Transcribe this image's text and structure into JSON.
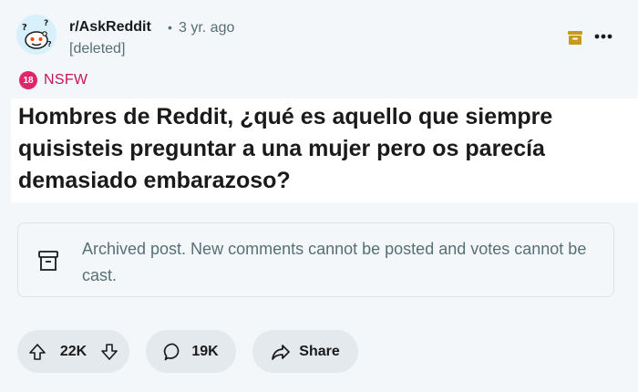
{
  "header": {
    "subreddit": "r/AskReddit",
    "separator": "•",
    "time_ago": "3 yr. ago",
    "author": "[deleted]",
    "avatar_icon": "subreddit-avatar-icon",
    "archive_icon": "archive-box-icon",
    "more_icon": "more-horizontal-icon"
  },
  "nsfw": {
    "badge": "18",
    "label": "NSFW",
    "color": "#e0266b"
  },
  "post": {
    "title": "Hombres de Reddit, ¿qué es aquello que siempre quisisteis preguntar a una mujer pero os parecía demasiado embarazoso?"
  },
  "notice": {
    "icon": "archive-icon",
    "text": "Archived post. New comments cannot be posted and votes cannot be cast."
  },
  "actions": {
    "votes": "22K",
    "comments": "19K",
    "share_label": "Share"
  },
  "colors": {
    "background": "#f4f7f9",
    "pill": "#e3e9ec",
    "archive_accent": "#c79a1b",
    "muted_text": "#576f76"
  }
}
